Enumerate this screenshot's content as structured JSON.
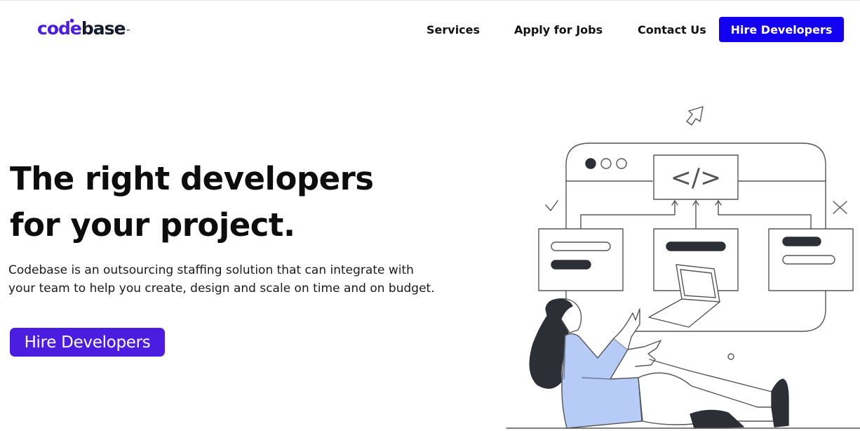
{
  "header": {
    "logo": {
      "part1": "code",
      "part2": "base",
      "tm": "™"
    },
    "nav": {
      "services": "Services",
      "apply_for_jobs": "Apply for Jobs",
      "contact_us": "Contact Us",
      "hire_developers": "Hire Developers"
    }
  },
  "hero": {
    "title_line1": "The right developers",
    "title_line2": "for your project.",
    "description_line1": "Codebase is an outsourcing staffing solution that can integrate with",
    "description_line2": "your team to help you create, design and scale on time and on budget.",
    "cta_label": "Hire Developers",
    "illustration": {
      "code_symbol": "</>",
      "icons": [
        "cursor-arrow-icon",
        "check-icon",
        "close-x-icon",
        "laptop-icon"
      ]
    }
  },
  "colors": {
    "logo_primary": "#4a1de0",
    "logo_dark": "#141a2e",
    "nav_button": "#1400f0",
    "hero_button": "#4a1de0",
    "illustration_accent": "#b6ccf7",
    "illustration_dark": "#2d2f36"
  }
}
